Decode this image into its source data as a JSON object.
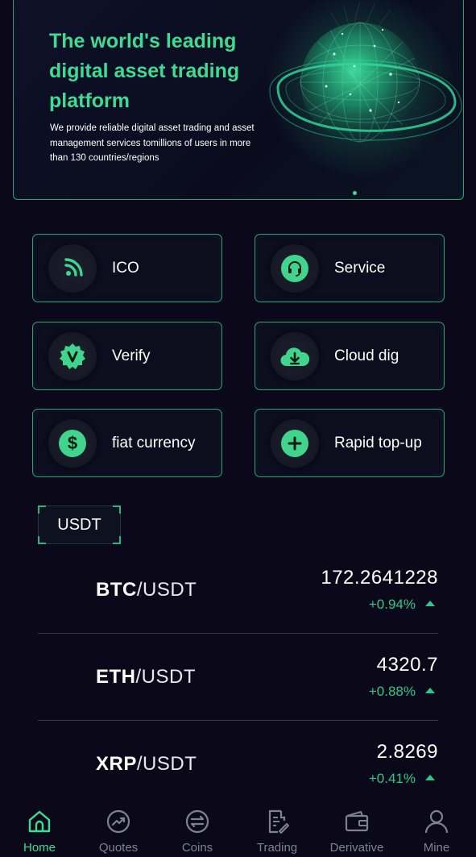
{
  "banner": {
    "title": "The world's leading digital asset trading platform",
    "description": "We provide reliable digital asset trading and asset management services tomillions  of users in more than 130 countries/regions"
  },
  "functions": [
    {
      "label": "ICO",
      "icon": "rss-icon"
    },
    {
      "label": "Service",
      "icon": "headset-icon"
    },
    {
      "label": "Verify",
      "icon": "verified-badge-icon"
    },
    {
      "label": "Cloud dig",
      "icon": "cloud-download-icon"
    },
    {
      "label": "fiat currency",
      "icon": "dollar-icon"
    },
    {
      "label": "Rapid top-up",
      "icon": "plus-icon"
    }
  ],
  "market": {
    "tab": "USDT",
    "rows": [
      {
        "base": "BTC",
        "quote": "/USDT",
        "price": "172.2641228",
        "change": "+0.94%"
      },
      {
        "base": "ETH",
        "quote": "/USDT",
        "price": "4320.7",
        "change": "+0.88%"
      },
      {
        "base": "XRP",
        "quote": "/USDT",
        "price": "2.8269",
        "change": "+0.41%"
      }
    ]
  },
  "nav": [
    {
      "label": "Home",
      "icon": "home-icon",
      "active": true
    },
    {
      "label": "Quotes",
      "icon": "trend-icon"
    },
    {
      "label": "Coins",
      "icon": "exchange-icon"
    },
    {
      "label": "Trading",
      "icon": "document-edit-icon"
    },
    {
      "label": "Derivative",
      "icon": "wallet-icon"
    },
    {
      "label": "Mine",
      "icon": "user-icon"
    }
  ],
  "colors": {
    "accent": "#3ddc92",
    "border": "#2aa37a",
    "background": "#0b0919",
    "positive": "#2fc78a"
  }
}
